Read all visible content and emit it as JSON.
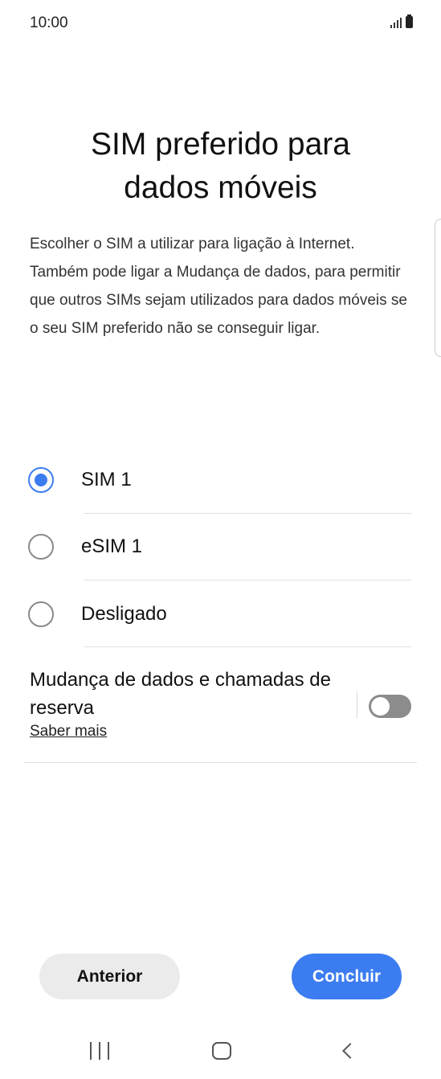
{
  "status_bar": {
    "time": "10:00",
    "signal_icon": "signal-bars-icon",
    "battery_icon": "battery-icon"
  },
  "title": {
    "line1": "SIM preferido para",
    "line2": "dados móveis"
  },
  "description": "Escolher o SIM a utilizar para ligação à Internet. Também pode ligar a Mudança de dados, para permitir que outros SIMs sejam utilizados para dados móveis se o seu SIM preferido não se conseguir ligar.",
  "options": [
    {
      "label": "SIM 1",
      "selected": true
    },
    {
      "label": "eSIM 1",
      "selected": false
    },
    {
      "label": "Desligado",
      "selected": false
    }
  ],
  "data_switch": {
    "label": "Mudança de dados e chamadas de reserva",
    "learn_more": "Saber mais",
    "enabled": false
  },
  "buttons": {
    "previous": "Anterior",
    "done": "Concluir"
  },
  "colors": {
    "accent": "#3b7cf0",
    "toggle_off": "#8c8c8c",
    "secondary_button": "#ebebeb"
  },
  "nav_bar": {
    "recent_icon": "recent-apps-icon",
    "home_icon": "home-icon",
    "back_icon": "back-icon"
  }
}
